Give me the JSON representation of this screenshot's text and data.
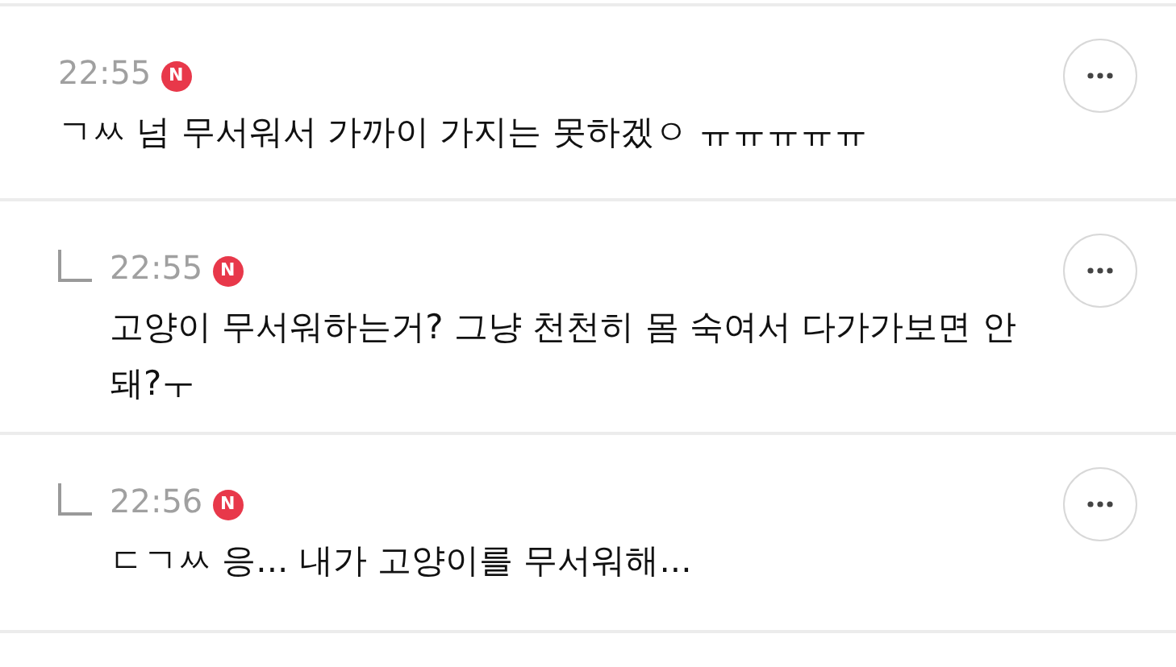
{
  "comments": [
    {
      "kind": "comment",
      "time": "22:55",
      "badge": "N",
      "text": "ㄱㅆ 넘 무서워서 가까이 가지는 못하겠ㅇ ㅠㅠㅠㅠㅠ"
    },
    {
      "kind": "reply",
      "time": "22:55",
      "badge": "N",
      "text": "고양이 무서워하는거? 그냥 천천히 몸 숙여서 다가가보면 안돼?ㅜ"
    },
    {
      "kind": "reply",
      "time": "22:56",
      "badge": "N",
      "text": "ㄷㄱㅆ 응... 내가 고양이를 무서워해..."
    }
  ]
}
